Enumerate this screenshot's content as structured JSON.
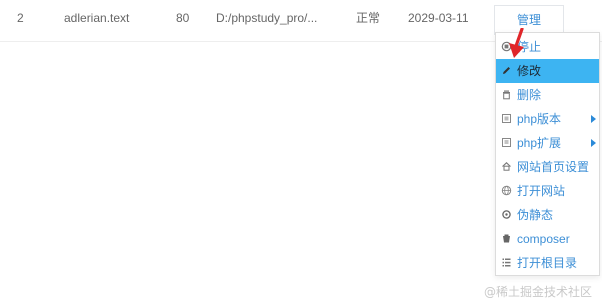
{
  "row": {
    "index": "2",
    "name": "adlerian.text",
    "port": "80",
    "path": "D:/phpstudy_pro/...",
    "status": "正常",
    "expire": "2029-03-11",
    "manage_label": "管理"
  },
  "menu": {
    "items": [
      {
        "label": "停止",
        "icon": "stop-icon"
      },
      {
        "label": "修改",
        "icon": "pencil-icon",
        "active": true
      },
      {
        "label": "删除",
        "icon": "trash-icon"
      },
      {
        "label": "php版本",
        "icon": "php-icon",
        "submenu": true
      },
      {
        "label": "php扩展",
        "icon": "extension-icon",
        "submenu": true
      },
      {
        "label": "网站首页设置",
        "icon": "home-icon"
      },
      {
        "label": "打开网站",
        "icon": "globe-icon"
      },
      {
        "label": "伪静态",
        "icon": "rewrite-icon"
      },
      {
        "label": "composer",
        "icon": "composer-icon"
      },
      {
        "label": "打开根目录",
        "icon": "folder-list-icon"
      }
    ]
  },
  "watermark": "@稀土掘金技术社区",
  "colors": {
    "accent": "#3d8fd6",
    "active_bg": "#3db4f2",
    "annotation": "#e0262a"
  }
}
